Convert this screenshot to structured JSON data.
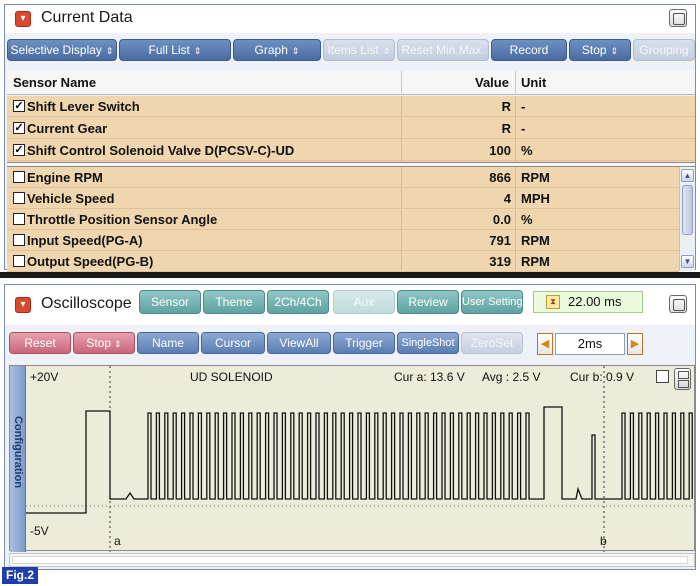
{
  "current_data": {
    "title": "Current Data",
    "toolbar": [
      {
        "label": "Selective Display",
        "arrow": "⇕",
        "enabled": true
      },
      {
        "label": "Full List",
        "arrow": "⇕",
        "enabled": true
      },
      {
        "label": "Graph",
        "arrow": "⇕",
        "enabled": true
      },
      {
        "label": "Items List",
        "arrow": "⇕",
        "enabled": false
      },
      {
        "label": "Reset Min.Max.",
        "arrow": "",
        "enabled": false
      },
      {
        "label": "Record",
        "arrow": "",
        "enabled": true
      },
      {
        "label": "Stop",
        "arrow": "⇕",
        "enabled": true
      },
      {
        "label": "Grouping",
        "arrow": "",
        "enabled": false
      }
    ],
    "columns": {
      "sensor": "Sensor Name",
      "value": "Value",
      "unit": "Unit"
    },
    "selected_rows": [
      {
        "checked": true,
        "name": "Shift Lever Switch",
        "value": "R",
        "unit": "-"
      },
      {
        "checked": true,
        "name": "Current Gear",
        "value": "R",
        "unit": "-"
      },
      {
        "checked": true,
        "name": "Shift Control Solenoid Valve D(PCSV-C)-UD",
        "value": "100",
        "unit": "%"
      }
    ],
    "other_rows": [
      {
        "checked": false,
        "name": "Engine RPM",
        "value": "866",
        "unit": "RPM"
      },
      {
        "checked": false,
        "name": "Vehicle Speed",
        "value": "4",
        "unit": "MPH"
      },
      {
        "checked": false,
        "name": "Throttle Position Sensor Angle",
        "value": "0.0",
        "unit": "%"
      },
      {
        "checked": false,
        "name": "Input Speed(PG-A)",
        "value": "791",
        "unit": "RPM"
      },
      {
        "checked": false,
        "name": "Output Speed(PG-B)",
        "value": "319",
        "unit": "RPM"
      }
    ]
  },
  "oscilloscope": {
    "title": "Oscilloscope",
    "tabs": [
      {
        "label": "Sensor",
        "enabled": true
      },
      {
        "label": "Theme",
        "enabled": true
      },
      {
        "label": "2Ch/4Ch",
        "enabled": true
      },
      {
        "label": "Aux",
        "enabled": false
      },
      {
        "label": "Review",
        "enabled": true
      },
      {
        "label": "User Setting",
        "enabled": true
      }
    ],
    "time_display": "22.00 ms",
    "controls": {
      "reset": "Reset",
      "stop": "Stop",
      "name": "Name",
      "cursor": "Cursor",
      "viewall": "ViewAll",
      "trigger": "Trigger",
      "singleshot": "SingleShot",
      "zeroset": "ZeroSet",
      "timebase": "2ms"
    },
    "channel": {
      "top_scale": "+20V",
      "bottom_scale": "-5V",
      "name": "UD SOLENOID",
      "cursor_a": "Cur a: 13.6 V",
      "average": "Avg : 2.5 V",
      "cursor_b": "Cur b:  0.9 V",
      "marker_a": "a",
      "marker_b": "b"
    },
    "side_tab": "Configuration"
  },
  "figure_label": "Fig.2",
  "colors": {
    "row_highlight": "#f0d6ae",
    "toolbar_blue": "#4a6ca3",
    "tab_teal": "#5fa3a2",
    "control_pink": "#c9657a",
    "scope_background": "#edecdb",
    "figure_label": "#1f3fa8"
  },
  "icons": {
    "panel_collapse": "collapse-chevron-icon",
    "maximize": "maximize-icon",
    "time": "hourglass-icon",
    "step_left": "triangle-left-icon",
    "step_right": "triangle-right-icon"
  }
}
